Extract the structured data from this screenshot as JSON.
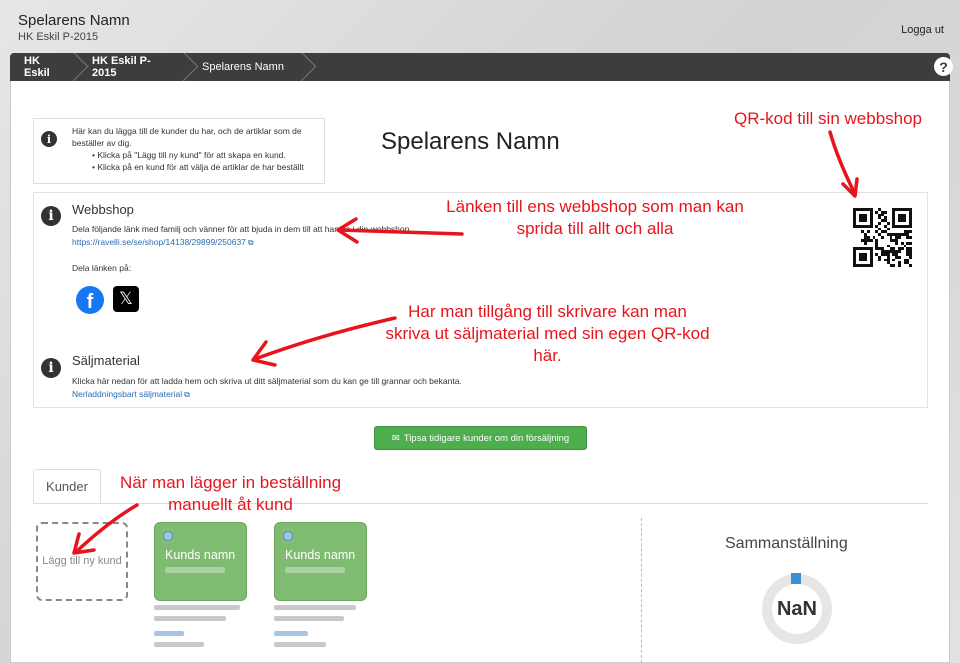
{
  "header": {
    "title": "Spelarens Namn",
    "subtitle": "HK Eskil P-2015",
    "logout_label": "Logga ut"
  },
  "breadcrumb": {
    "items": [
      "HK Eskil",
      "HK Eskil P-2015",
      "Spelarens Namn"
    ],
    "help_label": "?"
  },
  "intro": {
    "text": "Här kan du lägga till de kunder du har, och de artiklar som de beställer av dig.",
    "bullets": [
      "Klicka på \"Lägg till ny kund\" för att skapa en kund.",
      "Klicka på en kund för att välja de artiklar de har beställt"
    ]
  },
  "page_title": "Spelarens Namn",
  "webshop": {
    "heading": "Webbshop",
    "description": "Dela följande länk med familj och vänner för att bjuda in dem till att handla i din webbshop.",
    "link": "https://ravelli.se/se/shop/14138/29899/250637",
    "share_label": "Dela länken på:",
    "share_icons": [
      "facebook-icon",
      "x-twitter-icon"
    ]
  },
  "sales_material": {
    "heading": "Säljmaterial",
    "description": "Klicka här nedan för att ladda hem och skriva ut ditt säljmaterial som du kan ge till grannar och bekanta.",
    "link": "Nerladdningsbart säljmaterial"
  },
  "tip_button_label": "Tipsa tidigare kunder om din försäljning",
  "tabs": [
    {
      "label": "Kunder",
      "active": true
    }
  ],
  "customers": {
    "add_label": "Lägg till ny kund",
    "cards": [
      {
        "name": "Kunds namn",
        "status_color": "#7fbb71"
      },
      {
        "name": "Kunds namn",
        "status_color": "#7fbb71"
      }
    ]
  },
  "summary": {
    "title": "Sammanställning",
    "value": "NaN",
    "accent": "#3a8fd4"
  },
  "annotations": {
    "qr": "QR-kod till sin webbshop",
    "link": "Länken till ens webbshop som man kan sprida till allt och alla",
    "print": "Har man tillgång till skrivare kan man skriva ut säljmaterial med sin egen QR-kod här.",
    "manual": "När man lägger in beställning manuellt åt kund"
  },
  "colors": {
    "breadcrumb_bg": "#3d3d3d",
    "button_green": "#4cae4c",
    "card_green": "#7fbb71",
    "link_blue": "#2a6ab5",
    "annotation_red": "#e8141c"
  }
}
